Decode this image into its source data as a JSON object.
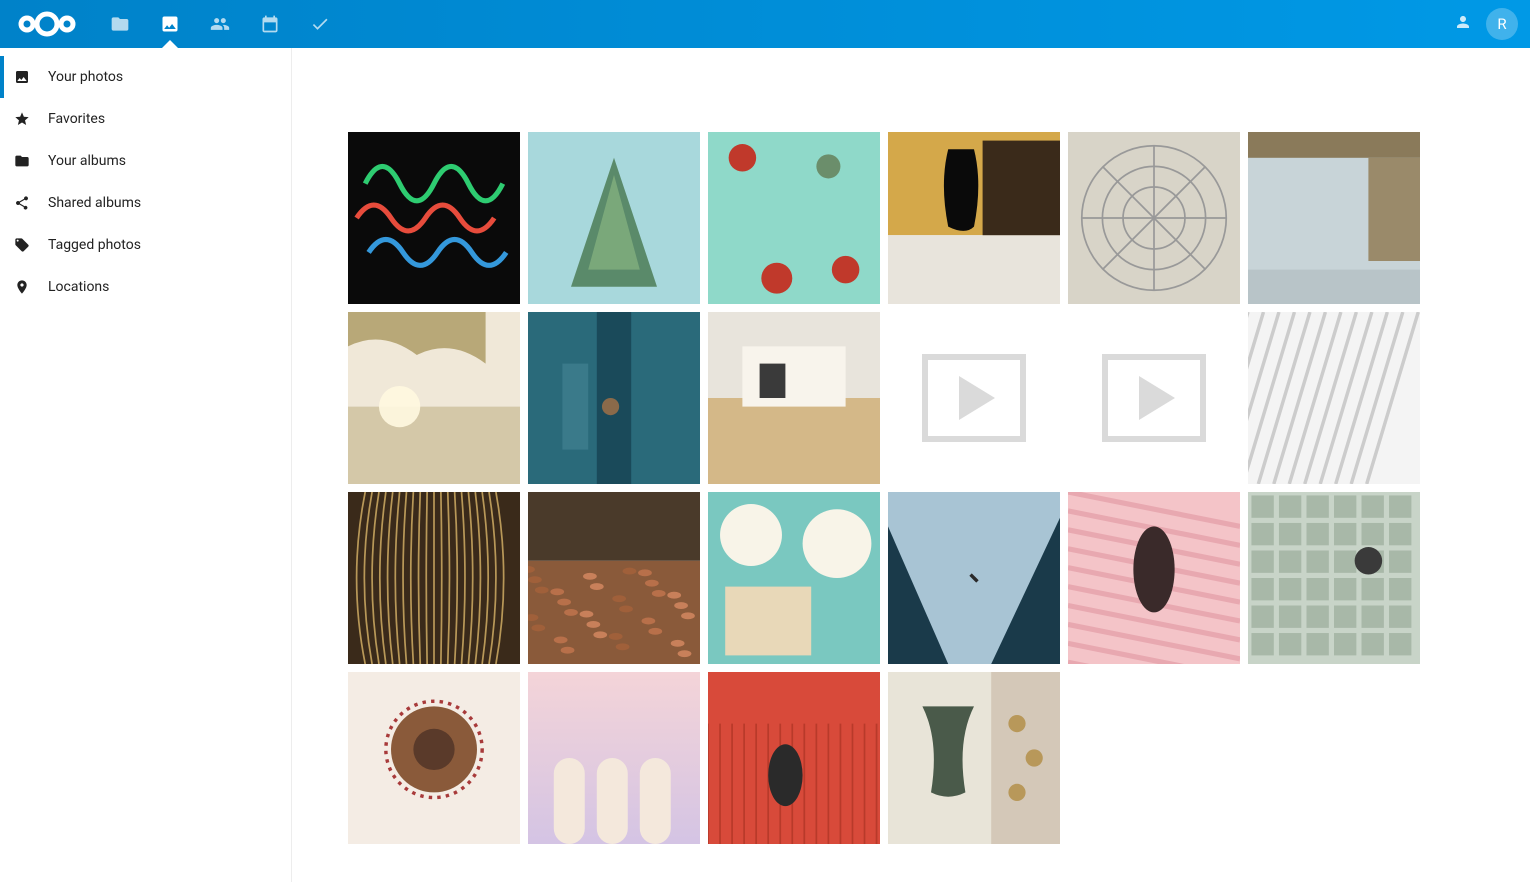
{
  "header": {
    "user_initial": "R"
  },
  "sidebar": {
    "items": [
      {
        "label": "Your photos",
        "icon": "photo",
        "active": true
      },
      {
        "label": "Favorites",
        "icon": "star",
        "active": false
      },
      {
        "label": "Your albums",
        "icon": "folder",
        "active": false
      },
      {
        "label": "Shared albums",
        "icon": "share",
        "active": false
      },
      {
        "label": "Tagged photos",
        "icon": "tag",
        "active": false
      },
      {
        "label": "Locations",
        "icon": "pin",
        "active": false
      }
    ]
  },
  "grid_count": 22,
  "video_indices": [
    9,
    10
  ]
}
